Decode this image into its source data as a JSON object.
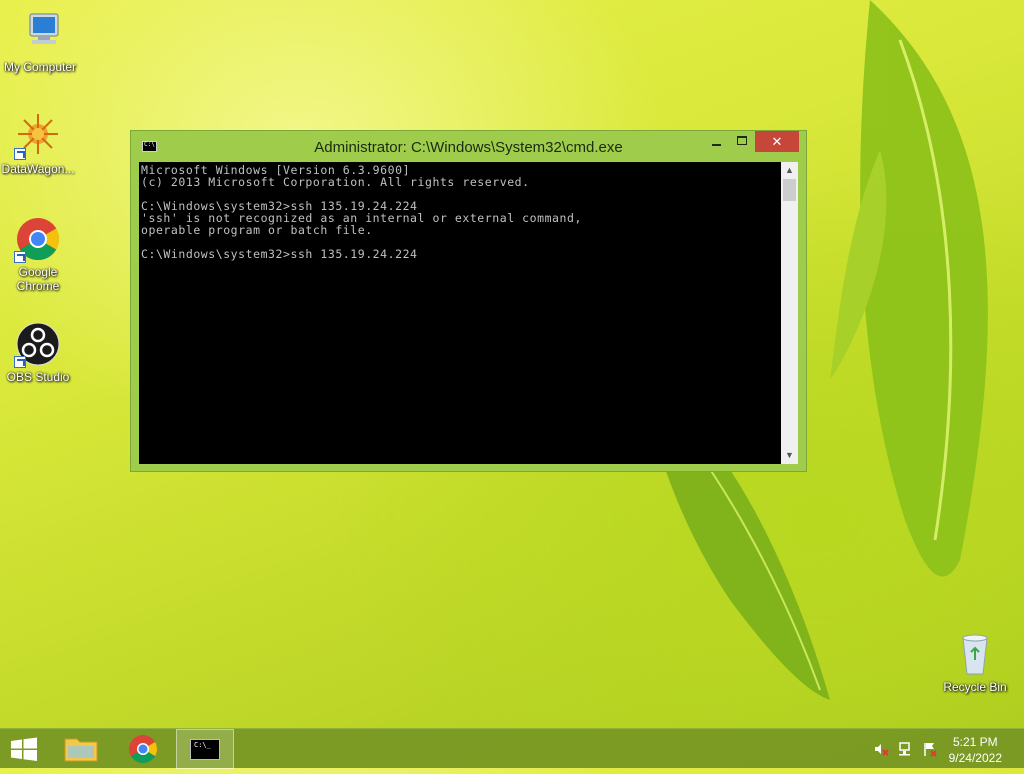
{
  "desktop": {
    "icons": [
      {
        "label": "My Computer"
      },
      {
        "label": "DataWagon..."
      },
      {
        "label": "Google Chrome"
      },
      {
        "label": "OBS Studio"
      },
      {
        "label": "Recycle Bin"
      }
    ]
  },
  "window": {
    "title": "Administrator: C:\\Windows\\System32\\cmd.exe",
    "close_glyph": "✕",
    "console_lines": [
      "Microsoft Windows [Version 6.3.9600]",
      "(c) 2013 Microsoft Corporation. All rights reserved.",
      "",
      "C:\\Windows\\system32>ssh 135.19.24.224",
      "'ssh' is not recognized as an internal or external command,",
      "operable program or batch file.",
      "",
      "C:\\Windows\\system32>ssh 135.19.24.224"
    ],
    "scroll_up_glyph": "▲",
    "scroll_down_glyph": "▼"
  },
  "taskbar": {
    "clock_time": "5:21 PM",
    "clock_date": "9/24/2022",
    "cmd_icon_text": "C:\\_"
  },
  "colors": {
    "accent": "#9fcd4b",
    "close": "#c7463a"
  }
}
